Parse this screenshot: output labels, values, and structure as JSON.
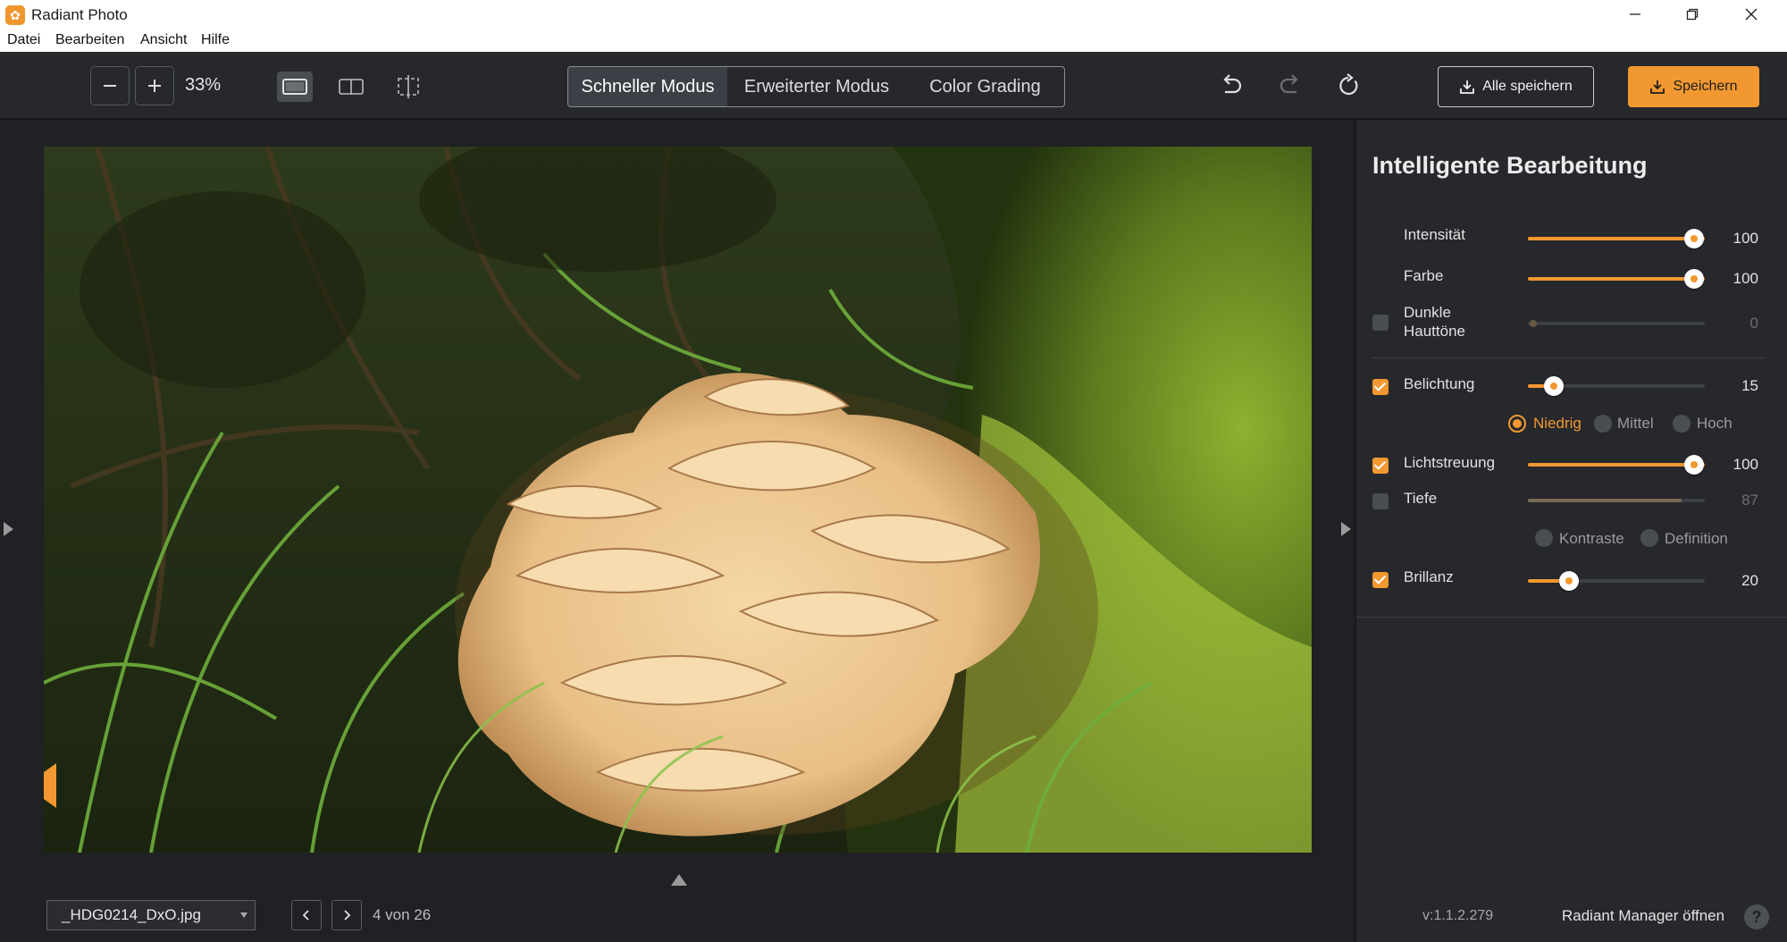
{
  "window": {
    "title": "Radiant Photo"
  },
  "menu": [
    "Datei",
    "Bearbeiten",
    "Ansicht",
    "Hilfe"
  ],
  "toolbar": {
    "zoom": "33%",
    "modes": [
      "Schneller Modus",
      "Erweiterter Modus",
      "Color Grading"
    ],
    "active_mode": "Schneller Modus",
    "save_all": "Alle speichern",
    "save": "Speichern"
  },
  "panel": {
    "title": "Intelligente Bearbeitung",
    "sliders": {
      "intensitaet": {
        "label": "Intensität",
        "value": "100"
      },
      "farbe": {
        "label": "Farbe",
        "value": "100"
      },
      "dunkle": {
        "label_1": "Dunkle",
        "label_2": "Hauttöne",
        "value": "0",
        "checked": false
      },
      "belichtung": {
        "label": "Belichtung",
        "value": "15",
        "checked": true
      },
      "lichtstreuung": {
        "label": "Lichtstreuung",
        "value": "100",
        "checked": true
      },
      "tiefe": {
        "label": "Tiefe",
        "value": "87",
        "checked": false
      },
      "brillanz": {
        "label": "Brillanz",
        "value": "20",
        "checked": true
      }
    },
    "exposure_options": [
      "Niedrig",
      "Mittel",
      "Hoch"
    ],
    "exposure_selected": "Niedrig",
    "depth_options": [
      "Kontraste",
      "Definition"
    ]
  },
  "footer": {
    "file": "_HDG0214_DxO.jpg",
    "counter": "4 von 26",
    "version": "v:1.1.2.279",
    "manager": "Radiant Manager öffnen",
    "help": "?"
  },
  "colors": {
    "accent": "#f29830",
    "background": "#1f2124",
    "panel": "#26282c"
  },
  "icons": [
    "app-logo-icon",
    "minimize-icon",
    "maximize-icon",
    "close-icon",
    "zoom-out-icon",
    "zoom-in-icon",
    "single-view-icon",
    "split-view-icon",
    "crop-view-icon",
    "undo-icon",
    "redo-icon",
    "reset-icon",
    "download-icon",
    "chevron-left-icon",
    "chevron-right-icon",
    "help-icon"
  ]
}
